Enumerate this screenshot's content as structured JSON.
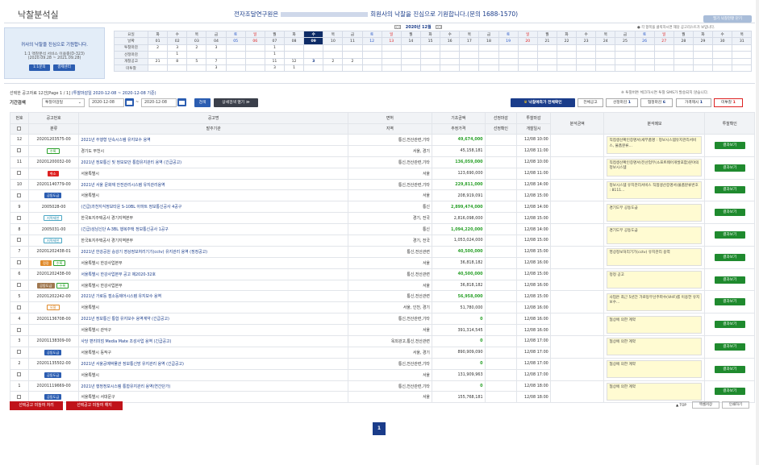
{
  "header": {
    "title": "낙찰분석실",
    "welcome_prefix": "전자조달연구원은",
    "welcome_suffix": "회원사의 낙찰을 진심으로 기원합니다.(문의 1688-1570)",
    "notice_button": "필기 낙찰현황 닫기"
  },
  "left_box": {
    "line1": "귀사의 낙찰을 진심으로 기원합니다.",
    "line2": "1:1 맥찰분석 서비스 이용중(D-323)",
    "line3": "(2020.09.28 ~ 2021.09.28)",
    "btn_inquiry": "1:1문의",
    "btn_payment": "결제센터"
  },
  "calendar": {
    "month_label": "2020년 12월",
    "prev": "<<",
    "next": ">>",
    "hint": "● 각 항목을 클릭하시면 해당 공고리스트가 보입니다.",
    "row_labels": [
      "요일",
      "날짜",
      "투찰마감",
      "선정마감",
      "개찰공고",
      "미투찰"
    ],
    "weekdays": [
      "화",
      "수",
      "목",
      "금",
      "토",
      "일",
      "월",
      "화",
      "수",
      "목",
      "금",
      "토",
      "일",
      "월",
      "화",
      "수",
      "목",
      "금",
      "토",
      "일",
      "월",
      "화",
      "수",
      "목",
      "금",
      "토",
      "일",
      "월",
      "화",
      "수",
      "목"
    ],
    "dates": [
      "01",
      "02",
      "03",
      "04",
      "05",
      "06",
      "07",
      "08",
      "09",
      "10",
      "11",
      "12",
      "13",
      "14",
      "15",
      "16",
      "17",
      "18",
      "19",
      "20",
      "21",
      "22",
      "23",
      "24",
      "25",
      "26",
      "27",
      "28",
      "29",
      "30",
      "31"
    ],
    "today_index": 8,
    "rows": [
      [
        "2",
        "3",
        "2",
        "3",
        "",
        "",
        "1",
        "",
        "",
        "",
        "",
        "",
        "",
        "",
        "",
        "",
        "",
        "",
        "",
        "",
        "",
        "",
        "",
        "",
        "",
        "",
        "",
        "",
        "",
        "",
        ""
      ],
      [
        "",
        "1",
        "",
        "",
        "",
        "",
        "1",
        "",
        "",
        "",
        "",
        "",
        "",
        "",
        "",
        "",
        "",
        "",
        "",
        "",
        "",
        "",
        "",
        "",
        "",
        "",
        "",
        "",
        "",
        "",
        ""
      ],
      [
        "21",
        "8",
        "5",
        "7",
        "",
        "",
        "11",
        "12",
        "3",
        "2",
        "2",
        "",
        "",
        "",
        "",
        "",
        "",
        "",
        "",
        "",
        "",
        "",
        "",
        "",
        "",
        "",
        "",
        "",
        "",
        "",
        ""
      ],
      [
        "",
        "",
        "",
        "3",
        "",
        "",
        "3",
        "1",
        "",
        "",
        "",
        "",
        "",
        "",
        "",
        "",
        "",
        "",
        "",
        "",
        "",
        "",
        "",
        "",
        "",
        "",
        "",
        "",
        "",
        "",
        ""
      ]
    ]
  },
  "result_info": {
    "text": "선택한 공고자료 12건[Page 1 / 1]",
    "period": "(투찰마감일 2020-12-08 ~ 2020-12-08 기준)"
  },
  "sms_note": "※ 투찰버튼 체크하시면 투찰 SMS가 발송되지 않습니다.",
  "search": {
    "label": "기간검색",
    "select_value": "투찰마감일",
    "date_from": "2020-12-08",
    "date_to": "2020-12-08",
    "search_button": "검색",
    "detail_button": "상세검색 열기 ≫",
    "predict_button": "낙찰예측가 전체확인",
    "filter_all": "전체공고",
    "filter_select_label": "선정마감",
    "filter_select_count": "1",
    "filter_bid_label": "협정마감",
    "filter_bid_count": "6",
    "filter_price_label": "가격제시",
    "filter_price_count": "1",
    "filter_none_label": "미투찰",
    "filter_none_count": "1"
  },
  "table": {
    "headers_top": [
      "번호",
      "공고번호",
      "공고명",
      "면허",
      "기초금액",
      "선정마감",
      "투찰마감",
      "분석금액",
      "분석메모",
      "투찰확인"
    ],
    "headers_bottom": [
      "분류",
      "발주기관",
      "지역",
      "추정가격",
      "선정확인",
      "개찰일시"
    ],
    "result_button": "결과보기",
    "rows": [
      {
        "no": "12",
        "notice_no": "20201203575-00",
        "badges": [
          {
            "text": "수록",
            "cls": "b-green"
          }
        ],
        "title": "2021년 주행형 단속시스템 유지보수 용역",
        "agency": "경기도 부천시",
        "license": "통신,전산관련,기타",
        "region": "서울, 경기",
        "base_amount": "49,674,000",
        "est_price": "45,158,181",
        "bid_close": "12/08 10:00",
        "open_date": "12/08 11:00",
        "memo": "직접생산확인증명서(세부품명 : 정보시스템유지관리서비스, 물품분류..."
      },
      {
        "no": "11",
        "notice_no": "20201200032-00",
        "badges": [
          {
            "text": "취소",
            "cls": "b-red"
          }
        ],
        "title": "2021년 정보통신 및 정보보안 통합유지관리 용역 (긴급공고)",
        "agency": "서울특별시",
        "license": "통신,전산관련,기타",
        "region": "서울",
        "base_amount": "136,059,000",
        "est_price": "123,690,000",
        "bid_close": "12/08 10:00",
        "open_date": "12/08 11:00",
        "memo": "직접생산확인증명서(전산업무(소프트웨어개발포함)분야의 정보시스템"
      },
      {
        "no": "10",
        "notice_no": "20201140779-00",
        "badges": [
          {
            "text": "공동도급",
            "cls": "b-blue"
          }
        ],
        "title": "2021년 서울 문화재 안전관리시스템 유지관리용역",
        "agency": "서울특별시",
        "license": "통신,전산관련,기타",
        "region": "서울",
        "base_amount": "229,811,000",
        "est_price": "208,919,091",
        "bid_close": "12/08 14:00",
        "open_date": "12/08 15:00",
        "memo": "정보시스템 유지관리서비스 직접생산증명서(물품분류번호 : 8111..."
      },
      {
        "no": "9",
        "notice_no": "2005028-00",
        "badges": [
          {
            "text": "지역제한",
            "cls": "b-teal"
          }
        ],
        "title": "(긴급)과천지식정보타운 S-10BL 아파트 정보통신공사 4공구",
        "agency": "한국토지주택공사 경기지역본부",
        "license": "통신",
        "region": "경기, 전국",
        "base_amount": "2,899,474,000",
        "est_price": "2,816,098,000",
        "bid_close": "12/08 14:00",
        "open_date": "12/08 15:00",
        "memo": "경기도무 공동도급"
      },
      {
        "no": "8",
        "notice_no": "2005031-00",
        "badges": [
          {
            "text": "지역제한",
            "cls": "b-teal"
          }
        ],
        "title": "(긴급)성남신단 A-3BL 행복주택 정보통신공사 1공구",
        "agency": "한국토지주택공사 경기지역본부",
        "license": "통신",
        "region": "경기, 전국",
        "base_amount": "1,094,220,000",
        "est_price": "1,053,024,000",
        "bid_close": "12/08 14:00",
        "open_date": "12/08 15:00",
        "memo": "경기도무 공동도급"
      },
      {
        "no": "7",
        "notice_no": "20201202438-01",
        "badges": [
          {
            "text": "정정",
            "cls": "b-orange-f"
          },
          {
            "text": "수록",
            "cls": "b-green"
          }
        ],
        "title": "2021년 한강공원 승강기 영상정보처리기기(cctv) 유지관리 용역 (정정공고)",
        "agency": "서울특별시 한강사업본부",
        "license": "통신,전산관련",
        "region": "서울",
        "base_amount": "40,500,000",
        "est_price": "36,818,182",
        "bid_close": "12/08 15:00",
        "open_date": "12/08 16:00",
        "memo": "영상정보처리기기(cctv) 유지관리 용역"
      },
      {
        "no": "6",
        "notice_no": "20201202438-00",
        "badges": [
          {
            "text": "공동도급",
            "cls": "b-brown"
          },
          {
            "text": "수록",
            "cls": "b-green"
          }
        ],
        "title": "서울특별시 한강사업본부 공고 제2020-32호",
        "agency": "서울특별시 한강사업본부",
        "license": "통신,전산관련",
        "region": "서울",
        "base_amount": "40,500,000",
        "est_price": "36,818,182",
        "bid_close": "12/08 15:00",
        "open_date": "12/08 16:00",
        "memo": "정정 공고"
      },
      {
        "no": "5",
        "notice_no": "20201202242-00",
        "badges": [
          {
            "text": "유찰",
            "cls": "b-orange"
          }
        ],
        "title": "2021년 가로등 점소등제어시스템 유지보수 용역",
        "agency": "서울특별시",
        "license": "통신,전산관련",
        "region": "서울, 인천, 경기",
        "base_amount": "56,958,000",
        "est_price": "51,780,000",
        "bid_close": "12/08 15:00",
        "open_date": "12/08 16:00",
        "memo": "사업은 최근 5년간 가로등무선주파수(VHF)를 이용한 유지보수..."
      },
      {
        "no": "4",
        "notice_no": "20201136708-00",
        "badges": [],
        "title": "2021년 정보통신 통합 유지보수 용역계약 (긴급공고)",
        "agency": "서울특별시 관악구",
        "license": "통신,전산관련,기타",
        "region": "서울",
        "base_amount": "0",
        "est_price": "391,314,545",
        "bid_close": "12/08 16:00",
        "open_date": "12/08 16:00",
        "memo": "협상에 의한 계약"
      },
      {
        "no": "3",
        "notice_no": "20201138309-00",
        "badges": [
          {
            "text": "공동도급",
            "cls": "b-blue"
          }
        ],
        "title": "사당 편리미엄 Media Mate 조성사업 용역 (긴급공고)",
        "agency": "서울특별시 동작구",
        "license": "옥외광고,통신,전산관련",
        "region": "서울, 경기",
        "base_amount": "0",
        "est_price": "890,909,090",
        "bid_close": "12/08 17:00",
        "open_date": "12/08 17:00",
        "memo": "협상에 의한 계약"
      },
      {
        "no": "2",
        "notice_no": "20201135502-00",
        "badges": [
          {
            "text": "공동도급",
            "cls": "b-blue"
          }
        ],
        "title": "2021년 서울공예박물관 정보통신망 유지관리 용역 (긴급공고)",
        "agency": "서울특별시",
        "license": "통신,전산관련,기타",
        "region": "서울",
        "base_amount": "0",
        "est_price": "131,909,963",
        "bid_close": "12/08 17:00",
        "open_date": "12/08 17:00",
        "memo": "협상에 의한 계약"
      },
      {
        "no": "1",
        "notice_no": "20201119669-00",
        "badges": [
          {
            "text": "공동도급",
            "cls": "b-blue"
          }
        ],
        "title": "2021년 행정정보시스템 통합유지관리 용역(연간단가)",
        "agency": "서울특별시 서대문구",
        "license": "통신,전산관련,기타",
        "region": "서울",
        "base_amount": "0",
        "est_price": "155,768,181",
        "bid_close": "12/08 18:00",
        "open_date": "12/08 18:00",
        "memo": "협상에 의한 계약"
      }
    ]
  },
  "bottom": {
    "btn_apply": "선택공고 미참여 처리",
    "btn_cancel": "선택공고 미참여 해지",
    "top_link": "▲ TOP",
    "excel": "엑셀저장",
    "print": "인쇄하기",
    "page": "1"
  }
}
